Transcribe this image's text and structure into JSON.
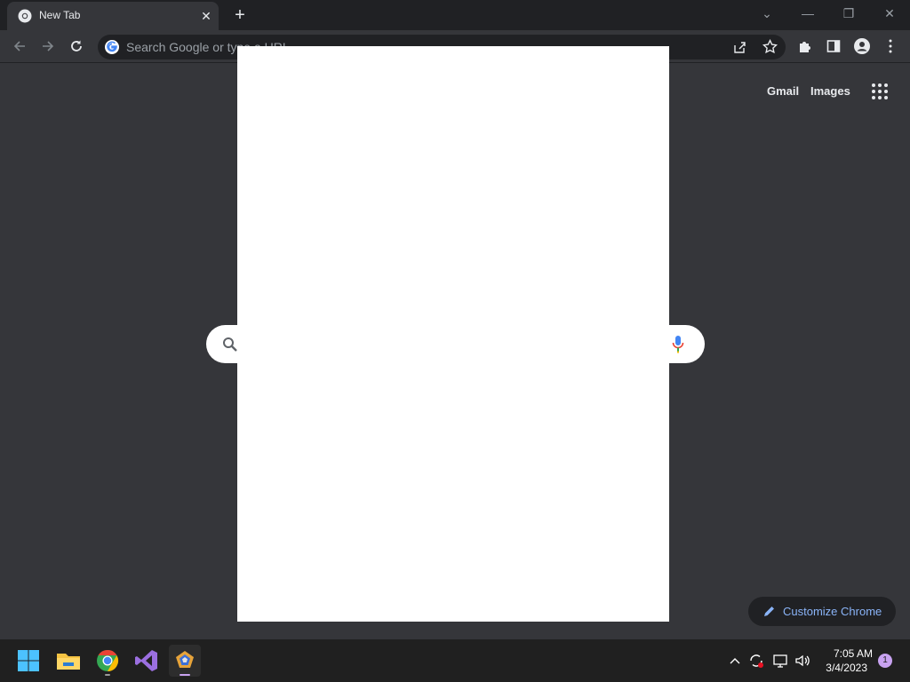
{
  "tab": {
    "title": "New Tab",
    "close_symbol": "✕",
    "new_tab_symbol": "+"
  },
  "window_controls": {
    "tab_search": "⌄",
    "minimize": "—",
    "restore": "❐",
    "close": "✕"
  },
  "toolbar": {
    "omnibox_placeholder": "Search Google or type a URL"
  },
  "content": {
    "gmail_label": "Gmail",
    "images_label": "Images",
    "search_placeholder": "",
    "customize_label": "Customize Chrome"
  },
  "taskbar": {
    "time": "7:05 AM",
    "date": "3/4/2023",
    "notification_count": "1"
  },
  "colors": {
    "chrome_dark": "#202124",
    "chrome_surface": "#35363a",
    "link_blue": "#8ab4f8",
    "taskbar": "#202020"
  },
  "icons": [
    "chrome-icon",
    "close-icon",
    "plus-icon",
    "back-icon",
    "forward-icon",
    "reload-icon",
    "google-g-icon",
    "share-icon",
    "star-icon",
    "extensions-icon",
    "side-panel-icon",
    "profile-icon",
    "menu-icon",
    "apps-grid-icon",
    "search-icon",
    "mic-icon",
    "pencil-icon",
    "windows-start-icon",
    "file-explorer-icon",
    "chrome-taskbar-icon",
    "visual-studio-icon",
    "app-pentagon-icon",
    "chevron-up-icon",
    "sync-icon",
    "network-icon",
    "volume-icon"
  ]
}
